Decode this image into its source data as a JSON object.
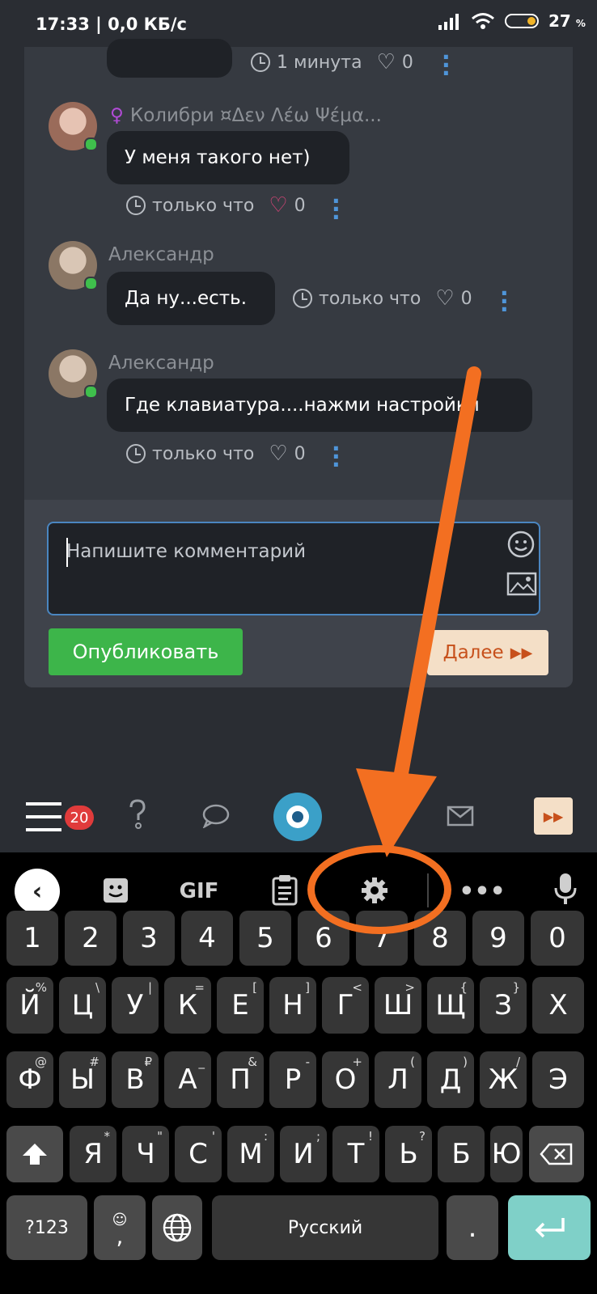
{
  "status_bar": {
    "time": "17:33",
    "speed": "0,0 КБ/с",
    "battery": "27",
    "battery_unit": "%"
  },
  "messages": [
    {
      "meta_time": "1 минута",
      "likes": "0"
    },
    {
      "author": "Колибри ¤Δεν Λέω Ψέμα...",
      "text": "У меня такого нет)",
      "meta_time": "только что",
      "likes": "0"
    },
    {
      "author": "Александр",
      "text": "Да ну...есть.",
      "meta_time": "только что",
      "likes": "0"
    },
    {
      "author": "Александр",
      "text": "Где клавиатура....нажми настройки",
      "meta_time": "только что",
      "likes": "0"
    }
  ],
  "composer": {
    "placeholder": "Напишите комментарий",
    "publish": "Опубликовать",
    "next": "Далее"
  },
  "bottom_nav": {
    "badge": "20"
  },
  "keyboard": {
    "toolbar": {
      "gif": "GIF"
    },
    "numbers": [
      "1",
      "2",
      "3",
      "4",
      "5",
      "6",
      "7",
      "8",
      "9",
      "0"
    ],
    "row1": [
      [
        "Й",
        "%"
      ],
      [
        "Ц",
        "\\"
      ],
      [
        "У",
        "|"
      ],
      [
        "К",
        "="
      ],
      [
        "Е",
        "["
      ],
      [
        "Н",
        "]"
      ],
      [
        "Г",
        "<"
      ],
      [
        "Ш",
        ">"
      ],
      [
        "Щ",
        "{"
      ],
      [
        "З",
        "}"
      ],
      [
        "Х",
        ""
      ]
    ],
    "row2": [
      [
        "Ф",
        "@"
      ],
      [
        "Ы",
        "#"
      ],
      [
        "В",
        "₽"
      ],
      [
        "А",
        "_"
      ],
      [
        "П",
        "&"
      ],
      [
        "Р",
        "-"
      ],
      [
        "О",
        "+"
      ],
      [
        "Л",
        "("
      ],
      [
        "Д",
        ")"
      ],
      [
        "Ж",
        "/"
      ],
      [
        "Э",
        ""
      ]
    ],
    "row3": [
      [
        "Я",
        "*"
      ],
      [
        "Ч",
        "\""
      ],
      [
        "С",
        "'"
      ],
      [
        "М",
        ":"
      ],
      [
        "И",
        ";"
      ],
      [
        "Т",
        "!"
      ],
      [
        "Ь",
        "?"
      ],
      [
        "Б",
        ""
      ],
      [
        "Ю",
        ""
      ]
    ],
    "symbols": "?123",
    "comma": ",",
    "space": "Русский",
    "period": "."
  },
  "colors": {
    "accent_orange": "#f36f21",
    "publish_green": "#3db54a",
    "link_blue": "#4f95d9",
    "liked_heart": "#e0457b"
  }
}
